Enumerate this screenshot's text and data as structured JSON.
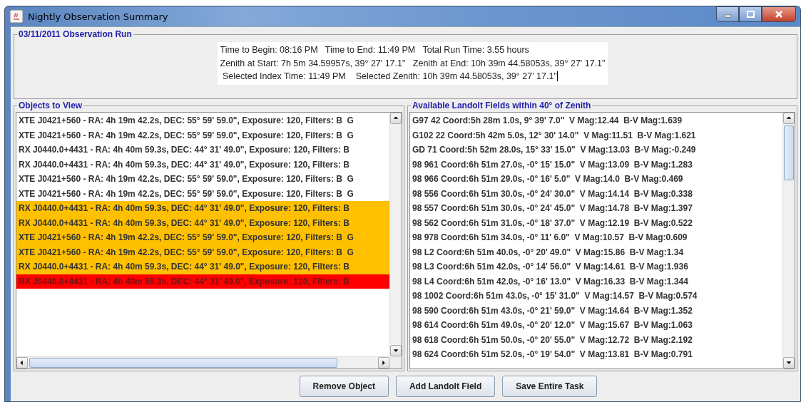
{
  "window": {
    "title": "Nightly Observation Summary"
  },
  "run": {
    "title": "03/11/2011 Observation Run",
    "lines": [
      "Time to Begin: 08:16 PM   Time to End: 11:49 PM   Total Run Time: 3.55 hours",
      "Zenith at Start: 7h 5m 34.59957s, 39° 27' 17.1\"   Zenith at End: 10h 39m 44.58053s, 39° 27' 17.1\"",
      " Selected Index Time: 11:49 PM    Selected Zenith: 10h 39m 44.58053s, 39° 27' 17.1\""
    ]
  },
  "objects": {
    "title": "Objects to View",
    "rows": [
      {
        "text": "XTE J0421+560 - RA: 4h 19m 42.2s, DEC: 55° 59' 59.0\", Exposure: 120, Filters: B  G",
        "color": "#ffffff"
      },
      {
        "text": "XTE J0421+560 - RA: 4h 19m 42.2s, DEC: 55° 59' 59.0\", Exposure: 120, Filters: B  G",
        "color": "#ffffff"
      },
      {
        "text": "RX J0440.0+4431 - RA: 4h 40m 59.3s, DEC: 44° 31' 49.0\", Exposure: 120, Filters: B",
        "color": "#ffffff"
      },
      {
        "text": "RX J0440.0+4431 - RA: 4h 40m 59.3s, DEC: 44° 31' 49.0\", Exposure: 120, Filters: B",
        "color": "#ffffff"
      },
      {
        "text": "XTE J0421+560 - RA: 4h 19m 42.2s, DEC: 55° 59' 59.0\", Exposure: 120, Filters: B  G",
        "color": "#ffffff"
      },
      {
        "text": "XTE J0421+560 - RA: 4h 19m 42.2s, DEC: 55° 59' 59.0\", Exposure: 120, Filters: B  G",
        "color": "#ffffff"
      },
      {
        "text": "RX J0440.0+4431 - RA: 4h 40m 59.3s, DEC: 44° 31' 49.0\", Exposure: 120, Filters: B",
        "color": "#ffc000"
      },
      {
        "text": "RX J0440.0+4431 - RA: 4h 40m 59.3s, DEC: 44° 31' 49.0\", Exposure: 120, Filters: B",
        "color": "#ffc000"
      },
      {
        "text": "XTE J0421+560 - RA: 4h 19m 42.2s, DEC: 55° 59' 59.0\", Exposure: 120, Filters: B  G",
        "color": "#ffc000"
      },
      {
        "text": "XTE J0421+560 - RA: 4h 19m 42.2s, DEC: 55° 59' 59.0\", Exposure: 120, Filters: B  G",
        "color": "#ffc000"
      },
      {
        "text": "RX J0440.0+4431 - RA: 4h 40m 59.3s, DEC: 44° 31' 49.0\", Exposure: 120, Filters: B",
        "color": "#ffc000"
      },
      {
        "text": "RX J0440.0+4431 - RA: 4h 40m 59.3s, DEC: 44° 31' 49.0\", Exposure: 120, Filters: B",
        "color": "#ff0000"
      }
    ]
  },
  "landolt": {
    "title": "Available Landolt Fields within 40° of Zenith",
    "rows": [
      "G97 42 Coord:5h 28m 1.0s, 9° 39' 7.0\"  V Mag:12.44  B-V Mag:1.639",
      "G102 22 Coord:5h 42m 5.0s, 12° 30' 14.0\"  V Mag:11.51  B-V Mag:1.621",
      "GD 71 Coord:5h 52m 28.0s, 15° 33' 15.0\"  V Mag:13.03  B-V Mag:-0.249",
      "98 961 Coord:6h 51m 27.0s, -0° 15' 15.0\"  V Mag:13.09  B-V Mag:1.283",
      "98 966 Coord:6h 51m 29.0s, -0° 16' 5.0\"  V Mag:14.0  B-V Mag:0.469",
      "98 556 Coord:6h 51m 30.0s, -0° 24' 30.0\"  V Mag:14.14  B-V Mag:0.338",
      "98 557 Coord:6h 51m 30.0s, -0° 24' 45.0\"  V Mag:14.78  B-V Mag:1.397",
      "98 562 Coord:6h 51m 31.0s, -0° 18' 37.0\"  V Mag:12.19  B-V Mag:0.522",
      "98 978 Coord:6h 51m 34.0s, -0° 11' 6.0\"  V Mag:10.57  B-V Mag:0.609",
      "98 L2 Coord:6h 51m 40.0s, -0° 20' 49.0\"  V Mag:15.86  B-V Mag:1.34",
      "98 L3 Coord:6h 51m 42.0s, -0° 14' 56.0\"  V Mag:14.61  B-V Mag:1.936",
      "98 L4 Coord:6h 51m 42.0s, -0° 16' 13.0\"  V Mag:16.33  B-V Mag:1.344",
      "98 1002 Coord:6h 51m 43.0s, -0° 15' 31.0\"  V Mag:14.57  B-V Mag:0.574",
      "98 590 Coord:6h 51m 43.0s, -0° 21' 59.0\"  V Mag:14.64  B-V Mag:1.352",
      "98 614 Coord:6h 51m 49.0s, -0° 20' 12.0\"  V Mag:15.67  B-V Mag:1.063",
      "98 618 Coord:6h 51m 50.0s, -0° 20' 55.0\"  V Mag:12.72  B-V Mag:2.192",
      "98 624 Coord:6h 51m 52.0s, -0° 19' 54.0\"  V Mag:13.81  B-V Mag:0.791"
    ]
  },
  "buttons": [
    "Remove Object",
    "Add Landolt Field",
    "Save Entire Task"
  ]
}
